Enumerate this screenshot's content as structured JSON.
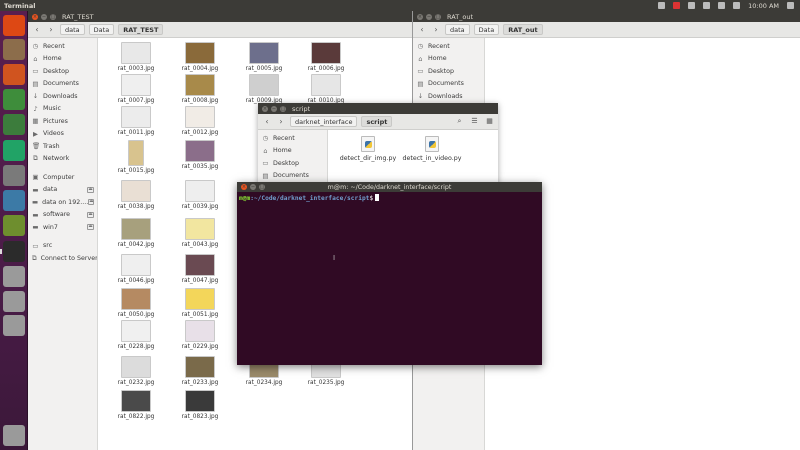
{
  "topbar": {
    "title": "Terminal",
    "clock": "10:00 AM"
  },
  "launcher": [
    {
      "name": "dash-icon",
      "color": "#dd4814"
    },
    {
      "name": "files-icon",
      "color": "#8c6d4b"
    },
    {
      "name": "firefox-icon",
      "color": "#d0541f"
    },
    {
      "name": "chrome-icon",
      "color": "#3e8d3b"
    },
    {
      "name": "calc-icon",
      "color": "#3c7c3c"
    },
    {
      "name": "pycharm-icon",
      "color": "#21a366"
    },
    {
      "name": "settings-icon",
      "color": "#7a7a7a"
    },
    {
      "name": "system-monitor-icon",
      "color": "#3c7aa6"
    },
    {
      "name": "synaptic-icon",
      "color": "#6e8e2e"
    },
    {
      "name": "terminal-icon",
      "color": "#2b2b2b"
    },
    {
      "name": "drive-icon",
      "color": "#9a9a9a"
    },
    {
      "name": "drive-2-icon",
      "color": "#9a9a9a"
    },
    {
      "name": "drive-3-icon",
      "color": "#9a9a9a"
    },
    {
      "name": "trash-icon",
      "color": "#9a9a9a"
    }
  ],
  "fm_main": {
    "title": "RAT_TEST",
    "crumbs": [
      "data",
      "Data",
      "RAT_TEST"
    ],
    "sidebar": [
      {
        "label": "Recent",
        "icon": "clock-icon",
        "glyph": "◷"
      },
      {
        "label": "Home",
        "icon": "home-icon",
        "glyph": "⌂"
      },
      {
        "label": "Desktop",
        "icon": "desktop-icon",
        "glyph": "▭"
      },
      {
        "label": "Documents",
        "icon": "documents-icon",
        "glyph": "▤"
      },
      {
        "label": "Downloads",
        "icon": "downloads-icon",
        "glyph": "↓"
      },
      {
        "label": "Music",
        "icon": "music-icon",
        "glyph": "♪"
      },
      {
        "label": "Pictures",
        "icon": "pictures-icon",
        "glyph": "▦"
      },
      {
        "label": "Videos",
        "icon": "videos-icon",
        "glyph": "▶"
      },
      {
        "label": "Trash",
        "icon": "trash-icon",
        "glyph": "🗑"
      },
      {
        "label": "Network",
        "icon": "network-icon",
        "glyph": "⧉"
      }
    ],
    "devices": [
      {
        "label": "Computer",
        "icon": "computer-icon",
        "glyph": "▣",
        "eject": false
      },
      {
        "label": "data",
        "icon": "drive-icon",
        "glyph": "▬",
        "eject": true
      },
      {
        "label": "data on 192....",
        "icon": "drive-icon",
        "glyph": "▬",
        "eject": true
      },
      {
        "label": "software",
        "icon": "drive-icon",
        "glyph": "▬",
        "eject": true
      },
      {
        "label": "win7",
        "icon": "drive-icon",
        "glyph": "▬",
        "eject": true
      }
    ],
    "bookmarks": [
      {
        "label": "src",
        "icon": "folder-icon",
        "glyph": "▭"
      },
      {
        "label": "Connect to Server",
        "icon": "server-icon",
        "glyph": "⧉"
      }
    ],
    "files": [
      {
        "name": "rat_0003.jpg",
        "col": 0,
        "row": 0,
        "c": "#e8e8e8"
      },
      {
        "name": "rat_0004.jpg",
        "col": 1,
        "row": 0,
        "c": "#8a6a3a"
      },
      {
        "name": "rat_0005.jpg",
        "col": 2,
        "row": 0,
        "c": "#6d6f8c"
      },
      {
        "name": "rat_0006.jpg",
        "col": 3,
        "row": 0,
        "c": "#5a3a3a"
      },
      {
        "name": "rat_0007.jpg",
        "col": 0,
        "row": 1,
        "c": "#efefef"
      },
      {
        "name": "rat_0008.jpg",
        "col": 1,
        "row": 1,
        "c": "#a88a4a"
      },
      {
        "name": "rat_0009.jpg",
        "col": 2,
        "row": 1,
        "c": "#cfcfcf"
      },
      {
        "name": "rat_0010.jpg",
        "col": 3,
        "row": 1,
        "c": "#e6e6e6"
      },
      {
        "name": "rat_0011.jpg",
        "col": 0,
        "row": 2,
        "c": "#ececec"
      },
      {
        "name": "rat_0012.jpg",
        "col": 1,
        "row": 2,
        "c": "#f1ece6"
      },
      {
        "name": "rat_0015.jpg",
        "col": 0,
        "row": 3,
        "c": "#d8c38e",
        "portrait": true
      },
      {
        "name": "rat_0035.jpg",
        "col": 1,
        "row": 3,
        "c": "#8b6e8a"
      },
      {
        "name": "rat_0038.jpg",
        "col": 0,
        "row": 4,
        "c": "#e9dfd4"
      },
      {
        "name": "rat_0039.jpg",
        "col": 1,
        "row": 4,
        "c": "#eeeeee"
      },
      {
        "name": "rat_0042.jpg",
        "col": 0,
        "row": 5,
        "c": "#a7a07d"
      },
      {
        "name": "rat_0043.jpg",
        "col": 1,
        "row": 5,
        "c": "#f2e6a0"
      },
      {
        "name": "rat_0046.jpg",
        "col": 0,
        "row": 6,
        "c": "#efefef"
      },
      {
        "name": "rat_0047.jpg",
        "col": 1,
        "row": 6,
        "c": "#6a4a52"
      },
      {
        "name": "rat_0050.jpg",
        "col": 0,
        "row": 7,
        "c": "#b58a62"
      },
      {
        "name": "rat_0051.jpg",
        "col": 1,
        "row": 7,
        "c": "#f3d65a"
      },
      {
        "name": "rat_0228.jpg",
        "col": 0,
        "row": 8,
        "c": "#f0f0f0"
      },
      {
        "name": "rat_0229.jpg",
        "col": 1,
        "row": 8,
        "c": "#e8e0e8"
      },
      {
        "name": "rat_0232.jpg",
        "col": 0,
        "row": 9,
        "c": "#dcdcdc"
      },
      {
        "name": "rat_0233.jpg",
        "col": 1,
        "row": 9,
        "c": "#7a6a4a"
      },
      {
        "name": "rat_0234.jpg",
        "col": 2,
        "row": 9,
        "c": "#9a8a6a"
      },
      {
        "name": "rat_0235.jpg",
        "col": 3,
        "row": 9,
        "c": "#e0e0e0"
      },
      {
        "name": "rat_0822.jpg",
        "col": 0,
        "row": 10,
        "c": "#4a4a4a"
      },
      {
        "name": "rat_0823.jpg",
        "col": 1,
        "row": 10,
        "c": "#3a3a3a"
      }
    ]
  },
  "fm_out": {
    "title": "RAT_out",
    "crumbs": [
      "data",
      "Data",
      "RAT_out"
    ],
    "sidebar": [
      {
        "label": "Recent",
        "icon": "clock-icon",
        "glyph": "◷"
      },
      {
        "label": "Home",
        "icon": "home-icon",
        "glyph": "⌂"
      },
      {
        "label": "Desktop",
        "icon": "desktop-icon",
        "glyph": "▭"
      },
      {
        "label": "Documents",
        "icon": "documents-icon",
        "glyph": "▤"
      },
      {
        "label": "Downloads",
        "icon": "downloads-icon",
        "glyph": "↓"
      }
    ]
  },
  "script_win": {
    "title": "script",
    "crumbs": [
      "darknet_interface",
      "script"
    ],
    "sidebar": [
      {
        "label": "Recent",
        "icon": "clock-icon",
        "glyph": "◷"
      },
      {
        "label": "Home",
        "icon": "home-icon",
        "glyph": "⌂"
      },
      {
        "label": "Desktop",
        "icon": "desktop-icon",
        "glyph": "▭"
      },
      {
        "label": "Documents",
        "icon": "documents-icon",
        "glyph": "▤"
      }
    ],
    "files": [
      "detect_dir_img.py",
      "detect_in_video.py"
    ]
  },
  "terminal": {
    "title": "m@m: ~/Code/darknet_interface/script",
    "user": "m@m",
    "path": ":~/Code/darknet_interface/script",
    "symbol": "$"
  }
}
